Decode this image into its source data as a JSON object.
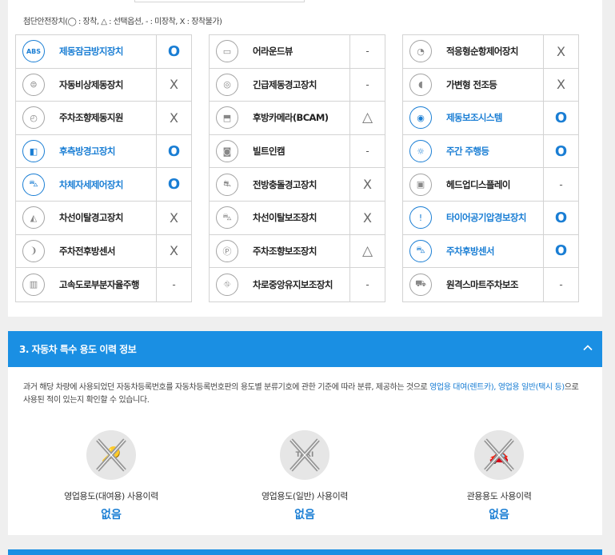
{
  "legend": "첨단안전장치(◯ : 장착, △ : 선택옵션, - : 미장착, X : 장착불가)",
  "features": [
    [
      {
        "name": "제동잠금방지장치",
        "status": "O",
        "icon": "abs-icon",
        "glyph": "ABS",
        "on": true
      },
      {
        "name": "자동비상제동장치",
        "status": "X",
        "icon": "emergency-brake-icon",
        "glyph": "⊜",
        "on": false
      },
      {
        "name": "주차조향제동지원",
        "status": "X",
        "icon": "parking-steer-icon",
        "glyph": "◴",
        "on": false
      },
      {
        "name": "후측방경고장치",
        "status": "O",
        "icon": "rear-side-warning-icon",
        "glyph": "◧",
        "on": true
      },
      {
        "name": "차체자세제어장치",
        "status": "O",
        "icon": "stability-control-icon",
        "glyph": "⛍",
        "on": true
      },
      {
        "name": "차선이탈경고장치",
        "status": "X",
        "icon": "lane-departure-warning-icon",
        "glyph": "◭",
        "on": false
      },
      {
        "name": "주차전후방센서",
        "status": "X",
        "icon": "parking-sensor-icon",
        "glyph": "❩",
        "on": false
      },
      {
        "name": "고속도로부분자율주행",
        "status": "-",
        "icon": "highway-drive-icon",
        "glyph": "▥",
        "on": false
      }
    ],
    [
      {
        "name": "어라운드뷰",
        "status": "-",
        "icon": "around-view-icon",
        "glyph": "▭",
        "on": false
      },
      {
        "name": "긴급제동경고장치",
        "status": "-",
        "icon": "brake-warning-icon",
        "glyph": "◎",
        "on": false
      },
      {
        "name": "후방카메라(BCAM)",
        "status": "△",
        "icon": "rear-camera-icon",
        "glyph": "⬒",
        "on": false
      },
      {
        "name": "빌트인캠",
        "status": "-",
        "icon": "builtin-cam-icon",
        "glyph": "◙",
        "on": false
      },
      {
        "name": "전방충돌경고장치",
        "status": "X",
        "icon": "forward-collision-icon",
        "glyph": "⛐",
        "on": false
      },
      {
        "name": "차선이탈보조장치",
        "status": "X",
        "icon": "lane-keep-assist-icon",
        "glyph": "⛍",
        "on": false
      },
      {
        "name": "주차조향보조장치",
        "status": "△",
        "icon": "parking-assist-icon",
        "glyph": "Ⓟ",
        "on": false
      },
      {
        "name": "차로중앙유지보조장치",
        "status": "-",
        "icon": "lane-center-icon",
        "glyph": "⛗",
        "on": false
      }
    ],
    [
      {
        "name": "적응형순항제어장치",
        "status": "X",
        "icon": "adaptive-cruise-icon",
        "glyph": "◔",
        "on": false
      },
      {
        "name": "가변형 전조등",
        "status": "X",
        "icon": "adaptive-headlight-icon",
        "glyph": "◖",
        "on": false
      },
      {
        "name": "제동보조시스템",
        "status": "O",
        "icon": "brake-assist-icon",
        "glyph": "◉",
        "on": true
      },
      {
        "name": "주간 주행등",
        "status": "O",
        "icon": "daytime-light-icon",
        "glyph": "☼",
        "on": true
      },
      {
        "name": "헤드업디스플레이",
        "status": "-",
        "icon": "head-up-display-icon",
        "glyph": "▣",
        "on": false
      },
      {
        "name": "타이어공기압경보장치",
        "status": "O",
        "icon": "tire-pressure-icon",
        "glyph": "!",
        "on": true
      },
      {
        "name": "주차후방센서",
        "status": "O",
        "icon": "rear-parking-sensor-icon",
        "glyph": "⛍",
        "on": true
      },
      {
        "name": "원격스마트주차보조",
        "status": "-",
        "icon": "remote-parking-icon",
        "glyph": "⛟",
        "on": false
      }
    ]
  ],
  "section3": {
    "title": "3. 자동차 특수 용도 이력 정보",
    "desc_a": "과거 해당 차량에 사용되었던 자동차등록번호를 자동차등록번호판의 용도별 분류기호에 관한 기준에 따라 분류, 제공하는 것으로 ",
    "desc_hl": "영업용 대여(렌트카), 영업용 일반(택시 등)",
    "desc_b": "으로",
    "desc_c": "사용된 적이 있는지 확인할 수 있습니다.",
    "uses": [
      {
        "label": "영업용도(대여용) 사용이력",
        "value": "없음",
        "icon": "rental-car-icon",
        "glyph": "🔑"
      },
      {
        "label": "영업용도(일반) 사용이력",
        "value": "없음",
        "icon": "taxi-icon",
        "glyph": "TAXI"
      },
      {
        "label": "관용용도 사용이력",
        "value": "없음",
        "icon": "government-car-icon",
        "glyph": "🚗"
      }
    ]
  },
  "colors": {
    "accent": "#1a8fe3",
    "on": "#1a7ed4"
  }
}
